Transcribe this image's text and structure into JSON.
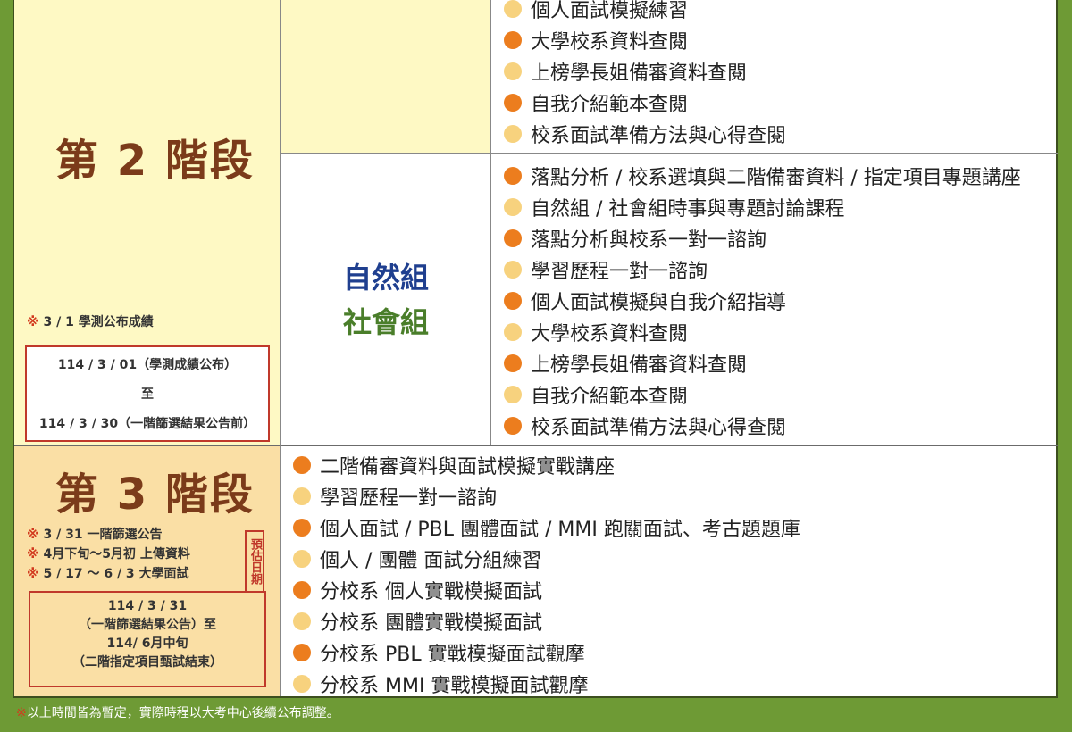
{
  "stage2": {
    "title": "第 2 階段",
    "note_mark": "※",
    "note": " 3 / 1 學測公布成績",
    "period_line1": "114 / 3 / 01（學測成績公布）",
    "period_line2": "至",
    "period_line3": "114 / 3 / 30（一階篩選結果公告前）",
    "top_items": [
      {
        "text": "個人面試模擬練習",
        "dot": "light"
      },
      {
        "text": "大學校系資料查閱",
        "dot": "dark"
      },
      {
        "text": "上榜學長姐備審資料查閱",
        "dot": "light"
      },
      {
        "text": "自我介紹範本查閱",
        "dot": "dark"
      },
      {
        "text": "校系面試準備方法與心得查閱",
        "dot": "light"
      }
    ],
    "group_natural": "自然組",
    "group_social": "社會組",
    "group_natural_color": "#1f3f8f",
    "group_social_color": "#4a7e2a",
    "bottom_items": [
      {
        "text": "落點分析 / 校系選填與二階備審資料 / 指定項目專題講座",
        "dot": "dark"
      },
      {
        "text": "自然組 / 社會組時事與專題討論課程",
        "dot": "light"
      },
      {
        "text": "落點分析與校系一對一諮詢",
        "dot": "dark"
      },
      {
        "text": "學習歷程一對一諮詢",
        "dot": "light"
      },
      {
        "text": "個人面試模擬與自我介紹指導",
        "dot": "dark"
      },
      {
        "text": "大學校系資料查閱",
        "dot": "light"
      },
      {
        "text": "上榜學長姐備審資料查閱",
        "dot": "dark"
      },
      {
        "text": "自我介紹範本查閱",
        "dot": "light"
      },
      {
        "text": "校系面試準備方法與心得查閱",
        "dot": "dark"
      }
    ]
  },
  "stage3": {
    "title": "第 3 階段",
    "notes": [
      {
        "mark": "※",
        "text": " 3 / 31 一階篩選公告"
      },
      {
        "mark": "※",
        "text": " 4月下旬〜5月初 上傳資料"
      },
      {
        "mark": "※",
        "text": " 5 / 17 〜 6 / 3 大學面試"
      }
    ],
    "estimate_label": "預估日期",
    "period_line1": "114 / 3 / 31",
    "period_line2": "（一階篩選結果公告）至",
    "period_line3": "114/ 6月中旬",
    "period_line4": "（二階指定項目甄試結束）",
    "items": [
      {
        "text": "二階備審資料與面試模擬實戰講座",
        "dot": "dark"
      },
      {
        "text": "學習歷程一對一諮詢",
        "dot": "light"
      },
      {
        "text": "個人面試 / PBL 團體面試 / MMI 跑關面試、考古題題庫",
        "dot": "dark"
      },
      {
        "text": "個人 / 團體 面試分組練習",
        "dot": "light"
      },
      {
        "text": "分校系 個人實戰模擬面試",
        "dot": "dark"
      },
      {
        "text": "分校系 團體實戰模擬面試",
        "dot": "light"
      },
      {
        "text": "分校系 PBL 實戰模擬面試觀摩",
        "dot": "dark"
      },
      {
        "text": "分校系 MMI 實戰模擬面試觀摩",
        "dot": "light"
      }
    ]
  },
  "footer": {
    "mark": "※",
    "text": "以上時間皆為暫定，實際時程以大考中心後續公布調整。"
  }
}
